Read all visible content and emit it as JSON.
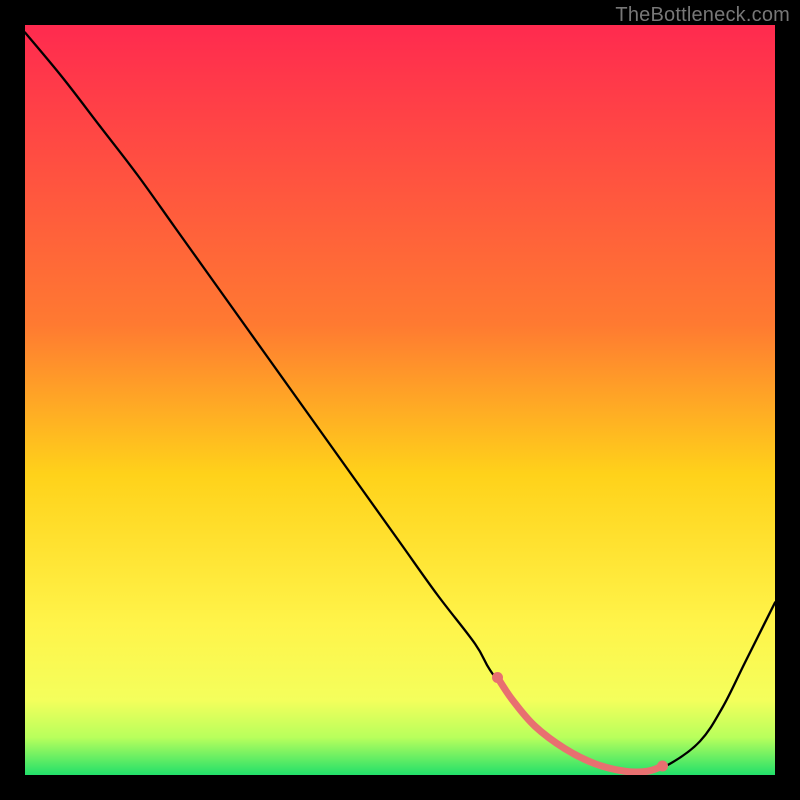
{
  "attribution": "TheBottleneck.com",
  "chart_data": {
    "type": "line",
    "title": "",
    "xlabel": "",
    "ylabel": "",
    "xlim": [
      0,
      100
    ],
    "ylim": [
      0,
      100
    ],
    "grid": false,
    "legend": false,
    "x": [
      0,
      5,
      10,
      15,
      20,
      25,
      30,
      35,
      40,
      45,
      50,
      55,
      60,
      62,
      65,
      68,
      72,
      76,
      80,
      83,
      86,
      90,
      93,
      96,
      100
    ],
    "values": [
      99,
      93,
      86.5,
      80,
      73,
      66,
      59,
      52,
      45,
      38,
      31,
      24,
      17.5,
      14,
      10,
      6.5,
      3.5,
      1.5,
      0.5,
      0.5,
      1.5,
      4.5,
      9,
      15,
      23
    ],
    "optimal_segment": {
      "x": [
        63,
        65,
        68,
        72,
        76,
        80,
        83,
        85
      ],
      "values": [
        13,
        10,
        6.5,
        3.5,
        1.5,
        0.5,
        0.5,
        1.2
      ]
    },
    "gradient_stops": [
      {
        "offset": 0,
        "color": "#ff2a4f"
      },
      {
        "offset": 40,
        "color": "#ff7a31"
      },
      {
        "offset": 60,
        "color": "#ffd21a"
      },
      {
        "offset": 80,
        "color": "#fff44a"
      },
      {
        "offset": 90,
        "color": "#f4ff5c"
      },
      {
        "offset": 95,
        "color": "#b8ff5c"
      },
      {
        "offset": 100,
        "color": "#22e06a"
      }
    ]
  }
}
